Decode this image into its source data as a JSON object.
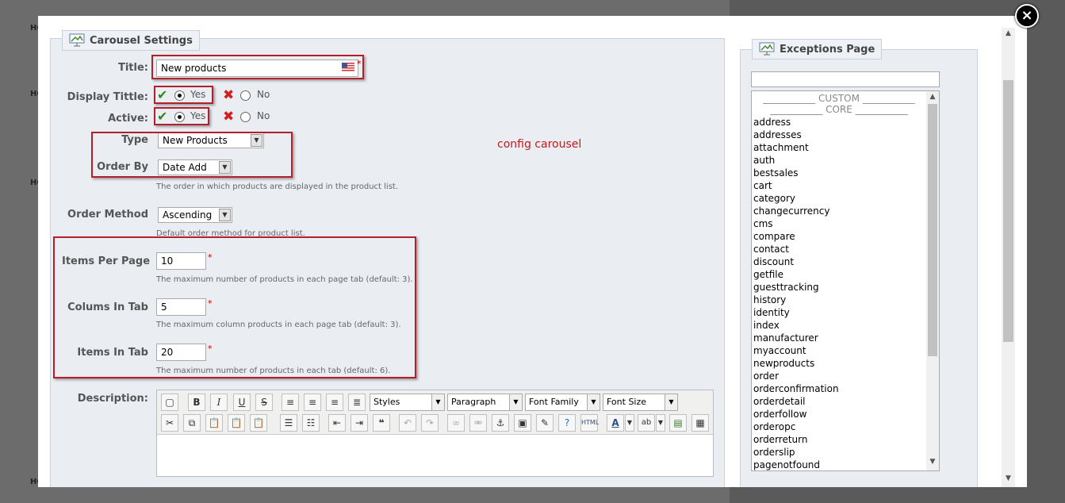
{
  "background": {
    "marks": [
      "HC",
      "HC",
      "HC",
      "HC"
    ]
  },
  "modal": {
    "close_glyph": "×"
  },
  "carousel": {
    "legend": "Carousel Settings",
    "title_label": "Title:",
    "title_value": "New products",
    "required_mark": "*",
    "display_title_label": "Display Tittle:",
    "active_label": "Active:",
    "yes": "Yes",
    "no": "No",
    "type_label": "Type",
    "type_value": "New Products",
    "order_by_label": "Order By",
    "order_by_value": "Date Add",
    "order_by_help": "The order in which products are displayed in the product list.",
    "order_method_label": "Order Method",
    "order_method_value": "Ascending",
    "order_method_help": "Default order method for product list.",
    "items_per_page_label": "Items Per Page",
    "items_per_page_value": "10",
    "items_per_page_help": "The maximum number of products in each page tab (default: 3).",
    "colums_label": "Colums In Tab",
    "colums_value": "5",
    "colums_help": "The maximum column products in each page tab (default: 3).",
    "items_in_tab_label": "Items In Tab",
    "items_in_tab_value": "20",
    "items_in_tab_help": "The maximum number of products in each tab (default: 6).",
    "description_label": "Description:",
    "annotation": "config carousel"
  },
  "editor": {
    "styles": "Styles",
    "paragraph": "Paragraph",
    "font_family": "Font Family",
    "font_size": "Font Size",
    "bold": "B",
    "italic": "I",
    "underline": "U",
    "strike": "S",
    "quote": "❝"
  },
  "exceptions": {
    "legend": "Exceptions Page",
    "separators": [
      "___________ CUSTOM ___________",
      "___________ CORE ___________"
    ],
    "items": [
      "address",
      "addresses",
      "attachment",
      "auth",
      "bestsales",
      "cart",
      "category",
      "changecurrency",
      "cms",
      "compare",
      "contact",
      "discount",
      "getfile",
      "guesttracking",
      "history",
      "identity",
      "index",
      "manufacturer",
      "myaccount",
      "newproducts",
      "order",
      "orderconfirmation",
      "orderdetail",
      "orderfollow",
      "orderopc",
      "orderreturn",
      "orderslip",
      "pagenotfound"
    ]
  }
}
